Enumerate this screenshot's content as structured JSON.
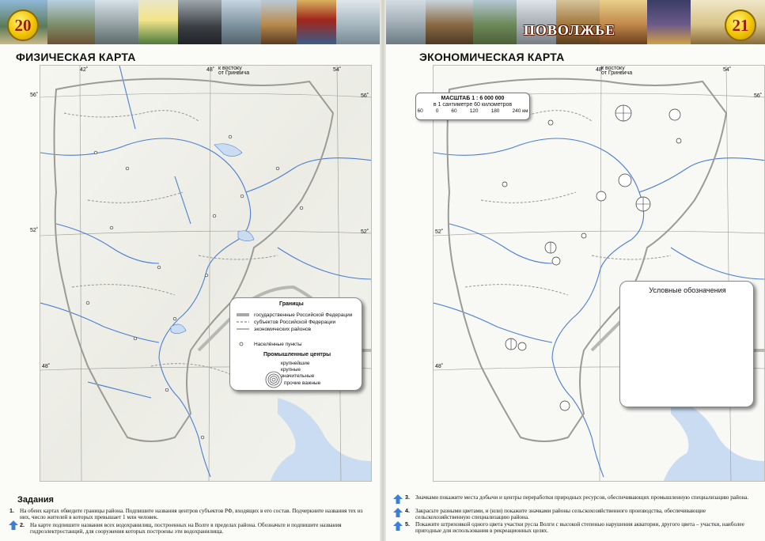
{
  "header": {
    "left_page_number": "20",
    "right_page_number": "21",
    "region_title": "ПОВОЛЖЬЕ"
  },
  "left_page": {
    "map_title": "ФИЗИЧЕСКАЯ КАРТА",
    "longitudes": [
      "42˚",
      "48˚",
      "54˚"
    ],
    "greenwich_note_line1": "к востоку",
    "greenwich_note_line2": "от Гринвича",
    "latitudes": [
      "56˚",
      "52˚",
      "48˚"
    ],
    "legend": {
      "borders_heading": "Границы",
      "border_items": [
        "государственные Российской Федерации",
        "субъектов Российской Федерации",
        "экономических районов"
      ],
      "settlements_label": "Населённые пункты",
      "industrial_heading": "Промышленные центры",
      "industrial_items": [
        "крупнейшие",
        "крупные",
        "значительные",
        "прочие важные"
      ]
    },
    "tasks_title": "Задания",
    "tasks": [
      {
        "number": "1.",
        "text": "На обеих картах обведите границы района. Подпишите названия центров субъектов РФ, входящих в его состав. Подчеркните названия тех из них, число жителей в которых превышает 1 млн человек."
      },
      {
        "number": "2.",
        "text": "На карте подпишите названия всех водохранилищ, построенных на Волге в пределах района. Обозначьте и подпишите названия гидроэлектростанций, для сооружения которых построены эти водохранилища."
      }
    ]
  },
  "right_page": {
    "map_title": "ЭКОНОМИЧЕСКАЯ КАРТА",
    "longitudes": [
      "48˚",
      "54˚"
    ],
    "greenwich_note_line1": "к востоку",
    "greenwich_note_line2": "от Гринвича",
    "latitudes": [
      "56˚",
      "52˚",
      "48˚"
    ],
    "scale": {
      "title": "МАСШТАБ 1 : 6 000 000",
      "subtitle": "в 1 сантиметре 60 километров",
      "ticks": [
        "60",
        "0",
        "60",
        "120",
        "180",
        "240 км"
      ]
    },
    "legend_title": "Условные обозначения",
    "tasks": [
      {
        "number": "3.",
        "text": "Значками покажите места добычи и центры переработки природных ресурсов, обеспечивающих промышленную специализацию района."
      },
      {
        "number": "4.",
        "text": "Закрасьте разными цветами, и (или) покажите значками районы сельскохозяйственного производства, обеспечивающие сельскохозяйственную специализацию района."
      },
      {
        "number": "5.",
        "text": "Покажите штриховкой одного цвета участки русла Волги с высокой степенью нарушения акватории, другого цвета – участки, наиболее пригодные для использования в рекреационных целях."
      }
    ]
  },
  "colors": {
    "river": "#4a7fd0",
    "water": "#c9dcf2",
    "state_border": "#a8a8a8",
    "page_number_fill": "#f0c400",
    "page_number_text": "#9b1b10",
    "task_arrow": "#3c7fd6"
  },
  "icons": [
    "task-arrow-icon",
    "ring-symbol-icon",
    "page-number-badge"
  ]
}
